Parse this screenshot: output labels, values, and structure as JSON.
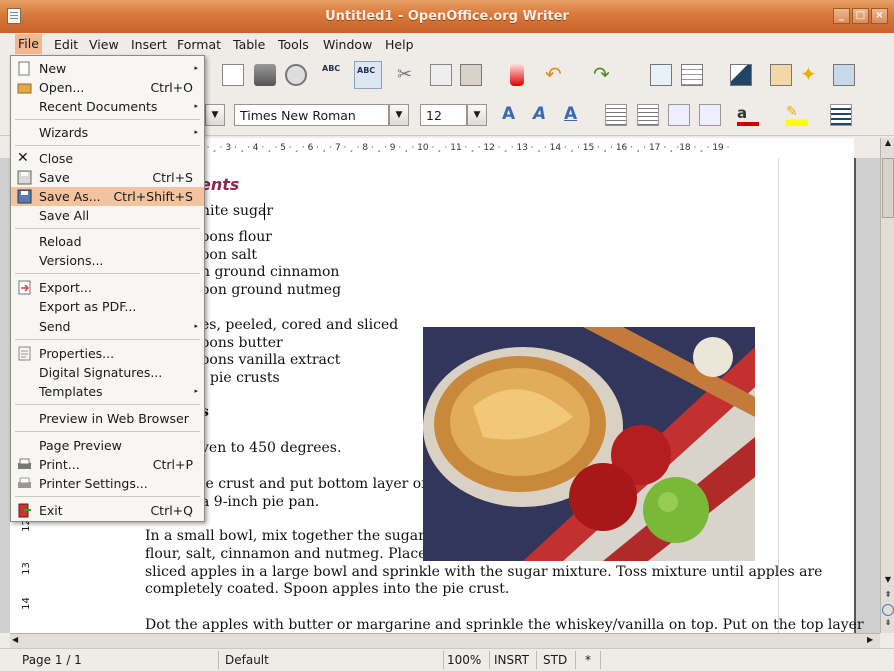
{
  "window": {
    "title": "Untitled1 - OpenOffice.org Writer"
  },
  "menubar": [
    "File",
    "Edit",
    "View",
    "Insert",
    "Format",
    "Table",
    "Tools",
    "Window",
    "Help"
  ],
  "formatting": {
    "font_name": "Times New Roman",
    "font_size": "12"
  },
  "ruler": "2 · ¸ · 3 · ¸ · 4 · ¸ · 5 · ¸ · 6 · ¸ · 7 · ¸ · 8 · ¸ · 9 · ¸ · 10 · ¸ · 11 · ¸ · 12 · ¸ · 13 · ¸ · 14 · ¸ · 15 · ¸ · 16 · ¸ · 17 · ¸ ·18 · ¸ · 19 ·",
  "left_ruler": {
    "r12": "12",
    "r13": "13",
    "r14": "14"
  },
  "file_menu": [
    {
      "label": "New",
      "accel": "",
      "submenu": true
    },
    {
      "label": "Open...",
      "accel": "Ctrl+O",
      "submenu": false
    },
    {
      "label": "Recent Documents",
      "accel": "",
      "submenu": true
    },
    {
      "label": "Wizards",
      "accel": "",
      "submenu": true
    },
    {
      "label": "Close",
      "accel": "",
      "submenu": false
    },
    {
      "label": "Save",
      "accel": "Ctrl+S",
      "submenu": false
    },
    {
      "label": "Save As...",
      "accel": "Ctrl+Shift+S",
      "submenu": false
    },
    {
      "label": "Save All",
      "accel": "",
      "submenu": false
    },
    {
      "label": "Reload",
      "accel": "",
      "submenu": false
    },
    {
      "label": "Versions...",
      "accel": "",
      "submenu": false
    },
    {
      "label": "Export...",
      "accel": "",
      "submenu": false
    },
    {
      "label": "Export as PDF...",
      "accel": "",
      "submenu": false
    },
    {
      "label": "Send",
      "accel": "",
      "submenu": true
    },
    {
      "label": "Properties...",
      "accel": "",
      "submenu": false
    },
    {
      "label": "Digital Signatures...",
      "accel": "",
      "submenu": false
    },
    {
      "label": "Templates",
      "accel": "",
      "submenu": true
    },
    {
      "label": "Preview in Web Browser",
      "accel": "",
      "submenu": false
    },
    {
      "label": "Page Preview",
      "accel": "",
      "submenu": false
    },
    {
      "label": "Print...",
      "accel": "Ctrl+P",
      "submenu": false
    },
    {
      "label": "Printer Settings...",
      "accel": "",
      "submenu": false
    },
    {
      "label": "Exit",
      "accel": "Ctrl+Q",
      "submenu": false
    }
  ],
  "document": {
    "heading": "ents",
    "lines": [
      "hite sugar",
      "oons flour",
      "oon salt",
      "n ground cinnamon",
      "oon ground nutmeg",
      "es, peeled, cored and sliced",
      "oons butter",
      "oons vanilla extract",
      "l pie crusts",
      "s",
      "ven to 450 degrees.",
      "ie crust and put bottom layer of",
      "a 9-inch pie pan.",
      "In a small bowl, mix together the sugar,",
      "flour, salt, cinnamon and nutmeg. Place",
      "sliced apples in a large bowl and sprinkle with the sugar mixture. Toss mixture until apples are",
      "completely coated. Spoon apples into the pie crust.",
      "Dot the apples with butter or margarine and sprinkle the whiskey/vanilla on top. Put on the top layer"
    ]
  },
  "status": {
    "page": "Page 1 / 1",
    "style": "Default",
    "zoom": "100%",
    "insert": "INSRT",
    "selection": "STD",
    "modified": "*"
  }
}
